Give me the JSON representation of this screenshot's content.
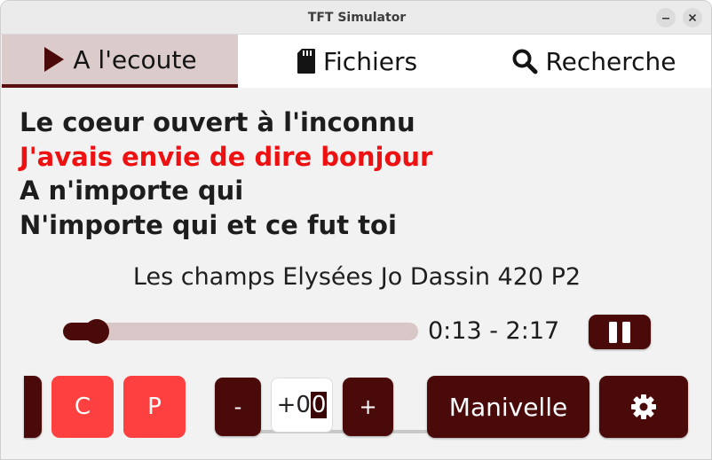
{
  "window": {
    "title": "TFT Simulator"
  },
  "tabs": [
    {
      "label": "A l'ecoute",
      "icon": "play-icon",
      "active": true
    },
    {
      "label": "Fichiers",
      "icon": "sd-card-icon",
      "active": false
    },
    {
      "label": "Recherche",
      "icon": "search-icon",
      "active": false
    }
  ],
  "lyrics": [
    {
      "text": "Le coeur ouvert à l'inconnu",
      "current": false
    },
    {
      "text": "J'avais envie de dire bonjour",
      "current": true
    },
    {
      "text": "A n'importe qui",
      "current": false
    },
    {
      "text": "N'importe qui et ce fut toi",
      "current": false
    }
  ],
  "song": {
    "title": "Les champs Elysées Jo Dassin 420 P2"
  },
  "playback": {
    "time": "0:13 - 2:17",
    "progress": 0.095,
    "state_icon": "pause-icon"
  },
  "controls": {
    "c_label": "C",
    "p_label": "P",
    "minus_label": "-",
    "plus_label": "+",
    "transpose_prefix": "+0",
    "transpose_selected": "0",
    "manivelle_label": "Manivelle",
    "settings_icon": "gear-icon"
  },
  "colors": {
    "accent": "#4a0a0a",
    "current_lyric": "#ee1111",
    "red_button": "#ff4040",
    "active_tab": "#dccbcb"
  }
}
